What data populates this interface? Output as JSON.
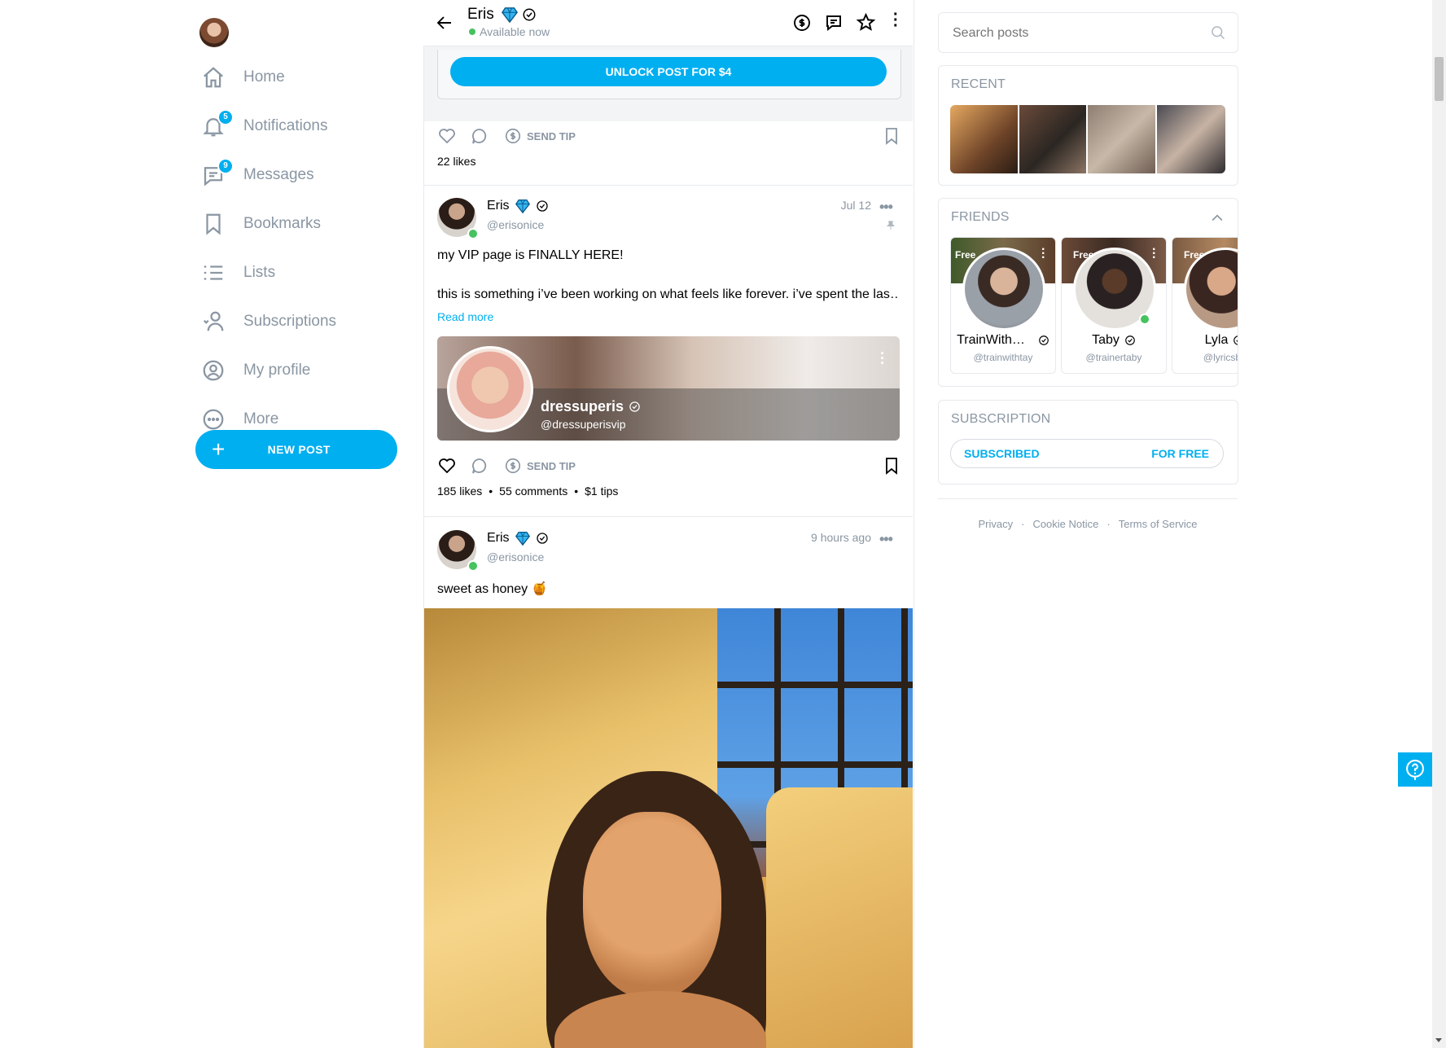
{
  "nav": {
    "items": [
      {
        "label": "Home",
        "icon": "home-icon"
      },
      {
        "label": "Notifications",
        "icon": "bell-icon",
        "badge": "5"
      },
      {
        "label": "Messages",
        "icon": "chat-icon",
        "badge": "9"
      },
      {
        "label": "Bookmarks",
        "icon": "bookmark-icon"
      },
      {
        "label": "Lists",
        "icon": "list-icon"
      },
      {
        "label": "Subscriptions",
        "icon": "user-heart-icon"
      },
      {
        "label": "My profile",
        "icon": "profile-icon"
      },
      {
        "label": "More",
        "icon": "more-circle-icon"
      }
    ],
    "new_post": "NEW POST"
  },
  "header": {
    "name": "Eris",
    "status": "Available now"
  },
  "locked_post": {
    "unlock_label": "UNLOCK POST FOR $4",
    "send_tip": "SEND TIP",
    "likes": "22 likes"
  },
  "post1": {
    "name": "Eris",
    "handle": "@erisonice",
    "date": "Jul 12",
    "line1": "my VIP page is FINALLY HERE!",
    "line2": "this is something i’ve been working on what feels like forever. i’ve spent the las…",
    "read_more": "Read more",
    "card_name": "dressuperis",
    "card_handle": "@dressuperisvip",
    "send_tip": "SEND TIP",
    "likes": "185 likes",
    "comments": "55 comments",
    "tips": "$1 tips"
  },
  "post2": {
    "name": "Eris",
    "handle": "@erisonice",
    "date": "9 hours ago",
    "text": "sweet as honey 🍯"
  },
  "sidebar": {
    "search_placeholder": "Search posts",
    "recent_title": "RECENT",
    "friends_title": "FRIENDS",
    "friends": [
      {
        "name": "TrainWith…",
        "handle": "@trainwithtay",
        "tag": "Free"
      },
      {
        "name": "Taby",
        "handle": "@trainertaby",
        "tag": "Free"
      },
      {
        "name": "Lyla",
        "handle": "@lyricsby",
        "tag": "Free"
      }
    ],
    "subscription_title": "SUBSCRIPTION",
    "subscribed": "SUBSCRIBED",
    "for_free": "FOR FREE"
  },
  "footer": {
    "privacy": "Privacy",
    "cookie": "Cookie Notice",
    "terms": "Terms of Service",
    "dot": "·"
  },
  "colors": {
    "accent": "#00aff0",
    "muted": "#8a96a3",
    "online": "#46c25f"
  }
}
